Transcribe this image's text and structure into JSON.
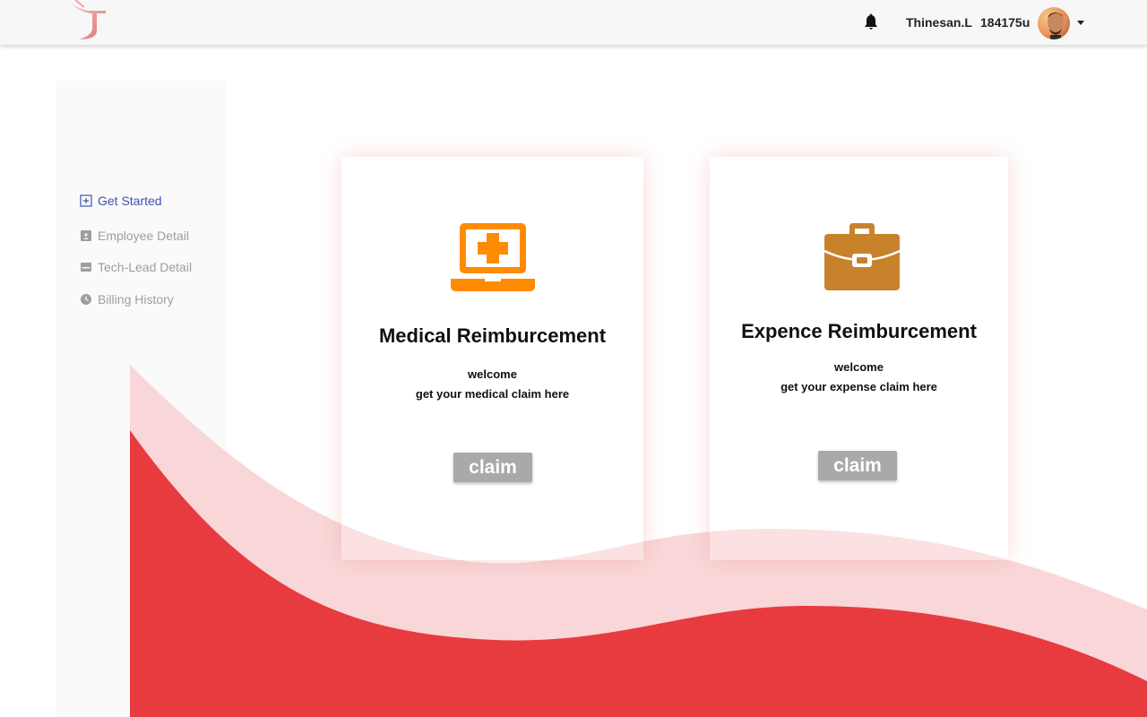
{
  "header": {
    "user_name": "Thinesan.L",
    "user_id": "184175u",
    "icons": [
      "app-logo",
      "bell-icon",
      "user-avatar",
      "caret-down-icon"
    ]
  },
  "sidebar": {
    "items": [
      {
        "label": "Get Started",
        "icon": "plus-square-icon",
        "active": true
      },
      {
        "label": "Employee Detail",
        "icon": "id-card-icon",
        "active": false
      },
      {
        "label": "Tech-Lead Detail",
        "icon": "card-icon",
        "active": false
      },
      {
        "label": "Billing History",
        "icon": "clock-icon",
        "active": false
      }
    ]
  },
  "cards": [
    {
      "title": "Medical Reimburcement",
      "line1": "welcome",
      "line2": "get your medical claim here",
      "button": "claim",
      "icon": "medical-laptop-icon",
      "icon_color": "#ff8c00"
    },
    {
      "title": "Expence Reimburcement",
      "line1": "welcome",
      "line2": "get your expense claim here",
      "button": "claim",
      "icon": "briefcase-icon",
      "icon_color": "#c9822c"
    }
  ],
  "colors": {
    "accent": "#3f51b5",
    "wave_dark": "#e83b40",
    "wave_light": "#f9d7d8",
    "button": "#a9a9a9"
  }
}
